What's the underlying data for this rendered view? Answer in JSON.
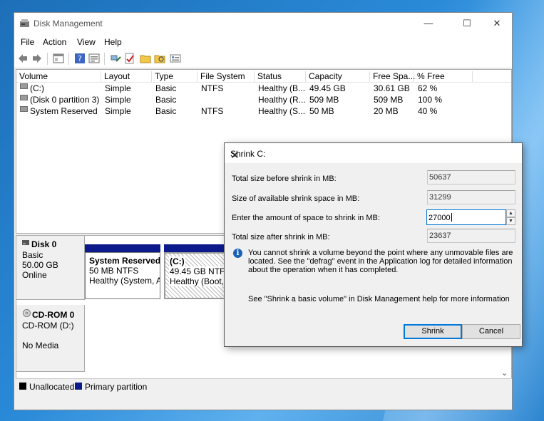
{
  "window": {
    "title": "Disk Management",
    "controls": {
      "minimize": "—",
      "maximize": "☐",
      "close": "✕"
    }
  },
  "menu": [
    "File",
    "Action",
    "View",
    "Help"
  ],
  "toolbar": [
    "back-icon",
    "forward-icon",
    "console-tree-icon",
    "help-icon",
    "properties-icon",
    "connect-icon",
    "check-icon",
    "folder-icon",
    "search-folder-icon",
    "settings-icon"
  ],
  "volume_table": {
    "columns": [
      "Volume",
      "Layout",
      "Type",
      "File System",
      "Status",
      "Capacity",
      "Free Spa...",
      "% Free"
    ],
    "rows": [
      {
        "volume": "(C:)",
        "layout": "Simple",
        "type": "Basic",
        "fs": "NTFS",
        "status": "Healthy (B...",
        "capacity": "49.45 GB",
        "free": "30.61 GB",
        "pct": "62 %"
      },
      {
        "volume": "(Disk 0 partition 3)",
        "layout": "Simple",
        "type": "Basic",
        "fs": "",
        "status": "Healthy (R...",
        "capacity": "509 MB",
        "free": "509 MB",
        "pct": "100 %"
      },
      {
        "volume": "System Reserved",
        "layout": "Simple",
        "type": "Basic",
        "fs": "NTFS",
        "status": "Healthy (S...",
        "capacity": "50 MB",
        "free": "20 MB",
        "pct": "40 %"
      }
    ]
  },
  "disks": [
    {
      "name": "Disk 0",
      "type": "Basic",
      "size": "50.00 GB",
      "state": "Online"
    },
    {
      "name": "CD-ROM 0",
      "type": "CD-ROM (D:)",
      "state": "No Media"
    }
  ],
  "partitions": [
    {
      "name": "System Reserved",
      "size": "50 MB NTFS",
      "status": "Healthy (System, A"
    },
    {
      "name": "(C:)",
      "size": "49.45 GB NTFS",
      "status": "Healthy (Boot, P"
    }
  ],
  "legend": {
    "items": [
      {
        "label": "Unallocated",
        "color": "#000000"
      },
      {
        "label": "Primary partition",
        "color": "#0c1a8c"
      }
    ]
  },
  "dialog": {
    "title": "Shrink C:",
    "close": "✕",
    "total_before_label": "Total size before shrink in MB:",
    "total_before": "50637",
    "available_label": "Size of available shrink space in MB:",
    "available": "31299",
    "amount_label": "Enter the amount of space to shrink in MB:",
    "amount": "27000",
    "total_after_label": "Total size after shrink in MB:",
    "total_after": "23637",
    "info": "You cannot shrink a volume beyond the point where any unmovable files are located. See the \"defrag\" event in the Application log for detailed information about the operation when it has completed.",
    "hint": "See \"Shrink a basic volume\" in Disk Management help for more information",
    "shrink_button": "Shrink",
    "cancel_button": "Cancel"
  },
  "colors": {
    "accent": "#0078d7",
    "primary_partition": "#0c1a8c",
    "info_icon": "#1a62b8"
  }
}
